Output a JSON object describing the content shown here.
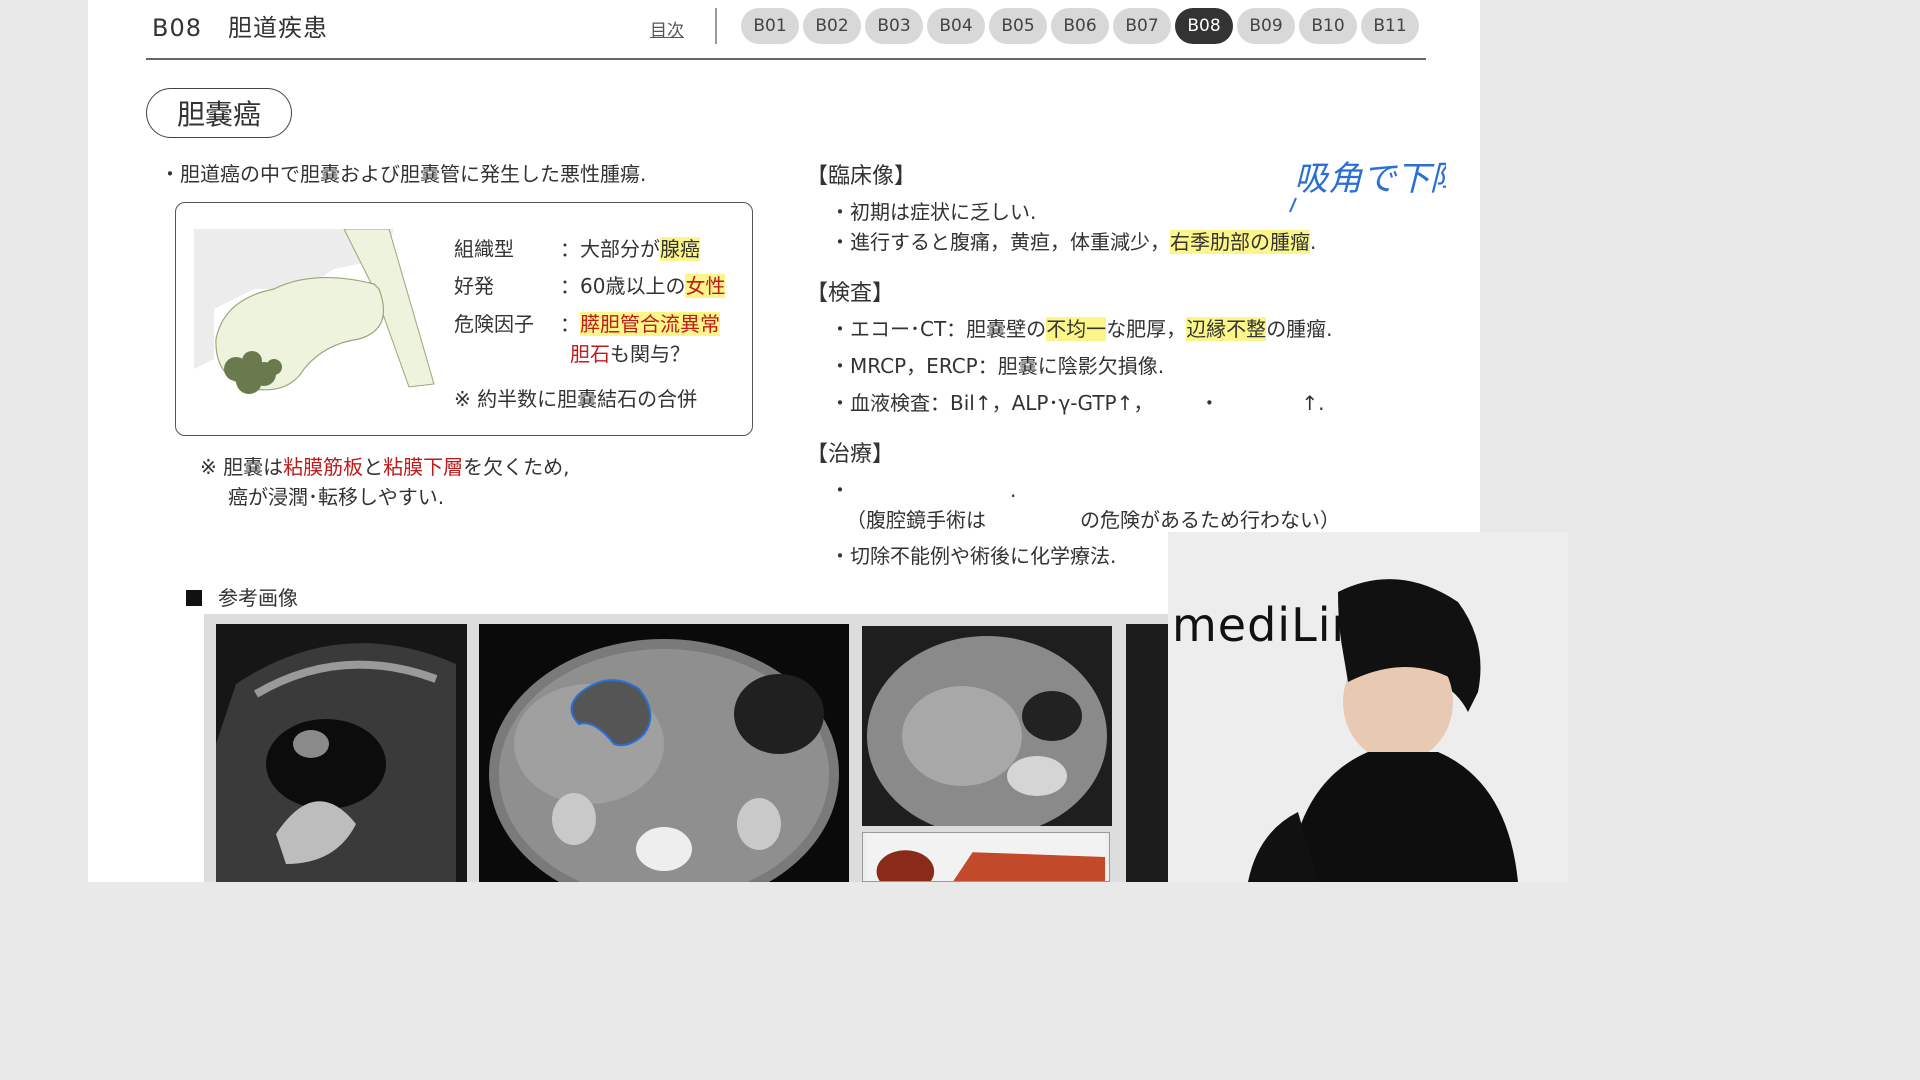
{
  "header": {
    "code": "B08",
    "title": "胆道疾患",
    "toc_label": "目次",
    "tabs": [
      "B01",
      "B02",
      "B03",
      "B04",
      "B05",
      "B06",
      "B07",
      "B08",
      "B09",
      "B10",
      "B11"
    ],
    "active_tab": "B08"
  },
  "section": {
    "title": "胆嚢癌",
    "intro": "・胆道癌の中で胆嚢および胆嚢管に発生した悪性腫瘍."
  },
  "infobox": {
    "rows": [
      {
        "label": "組織型",
        "pre": "：大部分が",
        "hl": "腺癌",
        "post": ""
      },
      {
        "label": "好発",
        "pre": "：60歳以上の",
        "hl": "女性",
        "post": ""
      },
      {
        "label": "危険因子",
        "pre": "：",
        "hl": "膵胆管合流異常",
        "post": ""
      }
    ],
    "row3_cont_red": "胆石",
    "row3_cont_post": "も関与？",
    "note": "※ 約半数に胆嚢結石の合併"
  },
  "note2": {
    "l1_a": "※ 胆嚢は",
    "l1_b": "粘膜筋板",
    "l1_c": "と",
    "l1_d": "粘膜下層",
    "l1_e": "を欠くため,",
    "l2": "癌が浸潤･転移しやすい."
  },
  "clinical": {
    "title": "【臨床像】",
    "l1": "・初期は症状に乏しい.",
    "l2_pre": "・進行すると腹痛，黄疸，体重減少，",
    "l2_hl": "右季肋部の腫瘤",
    "l2_post": "."
  },
  "exam": {
    "title": "【検査】",
    "l1_a": "・エコー･CT：胆嚢壁の",
    "l1_hl1": "不均一",
    "l1_b": "な肥厚，",
    "l1_hl2": "辺縁不整",
    "l1_c": "の腫瘤.",
    "l2": "・MRCP，ERCP：胆嚢に陰影欠損像.",
    "l3_a": "・血液検査：Bil↑，ALP･γ-GTP↑，",
    "l3_b": "・",
    "l3_c": "↑."
  },
  "treatment": {
    "title": "【治療】",
    "l1": "・",
    "l1_end": ".",
    "l2_a": "（腹腔鏡手術は",
    "l2_b": "の危険があるため行わない）",
    "l3": "・切除不能例や術後に化学療法."
  },
  "handwriting": "吸角で下障",
  "reference": {
    "title": "参考画像"
  },
  "webcam": {
    "logo": "mediLin"
  },
  "colors": {
    "highlight": "#fbf58a",
    "red_text": "#c01b1b",
    "active_tab": "#333333",
    "annotation_blue": "#2a6fd6"
  }
}
